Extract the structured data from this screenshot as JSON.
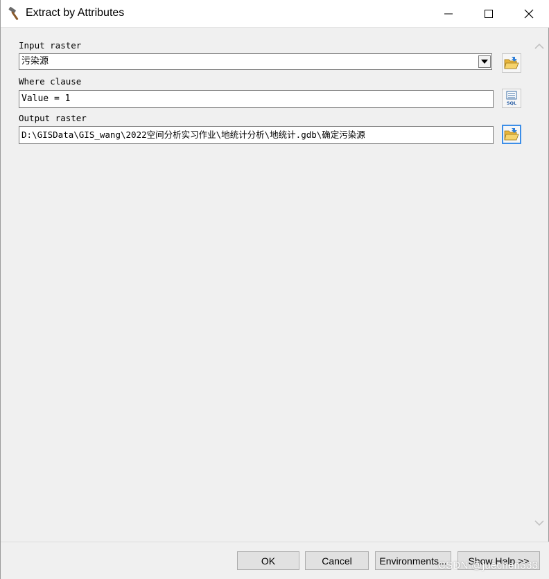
{
  "window": {
    "title": "Extract by Attributes",
    "title_icon": "hammer-icon"
  },
  "params": {
    "input_raster_label": "Input raster",
    "input_raster_value": "污染源",
    "where_clause_label": "Where clause",
    "where_clause_value": "Value = 1",
    "output_raster_label": "Output raster",
    "output_raster_value": "D:\\GISData\\GIS_wang\\2022空间分析实习作业\\地统计分析\\地统计.gdb\\确定污染源"
  },
  "buttons": {
    "ok": "OK",
    "cancel": "Cancel",
    "environments": "Environments...",
    "show_help": "Show Help >>"
  },
  "watermark": "CSDN @juechen333",
  "colors": {
    "focus_border": "#3c8ee8",
    "folder_yellow": "#f4c542"
  }
}
